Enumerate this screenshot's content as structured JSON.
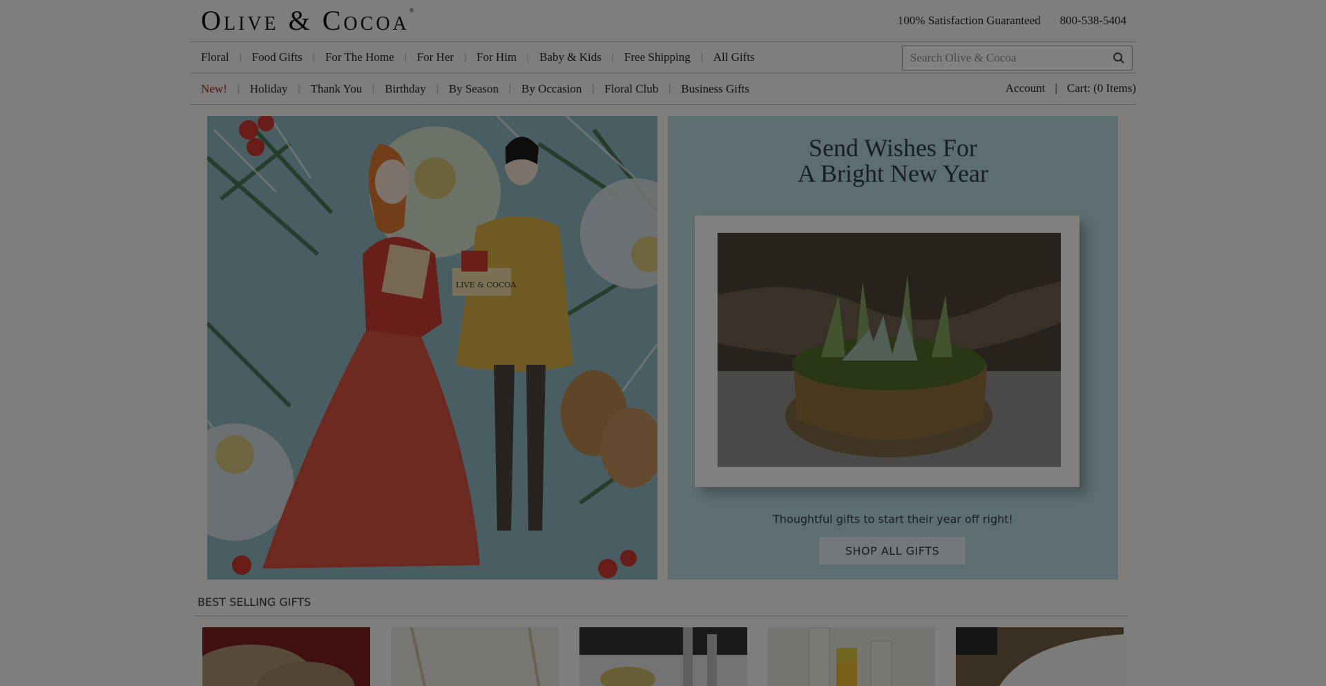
{
  "brand": {
    "logo_text": "Olive & Cocoa",
    "logo_mark": "®"
  },
  "header": {
    "guarantee": "100% Satisfaction Guaranteed",
    "phone": "800-538-5404"
  },
  "nav_primary": [
    "Floral",
    "Food Gifts",
    "For The Home",
    "For Her",
    "For Him",
    "Baby & Kids",
    "Free Shipping",
    "All Gifts"
  ],
  "search": {
    "placeholder": "Search Olive & Cocoa",
    "icon": "search-icon"
  },
  "nav_secondary": [
    "New!",
    "Holiday",
    "Thank You",
    "Birthday",
    "By Season",
    "By Occasion",
    "Floral Club",
    "Business Gifts"
  ],
  "account": {
    "account_label": "Account",
    "separator": "|",
    "cart_label": "Cart: (0 Items)"
  },
  "hero": {
    "title_line1": "Send Wishes For",
    "title_line2": "A Bright New Year",
    "subtitle": "Thoughtful gifts to start their year off right!",
    "cta_label": "SHOP ALL GIFTS",
    "illustration_box_text": "LIVE & COCOA"
  },
  "best_selling": {
    "heading": "BEST SELLING GIFTS"
  },
  "colors": {
    "accent_new": "#9a2a22",
    "hero_panel": "#b3d3d8",
    "overlay": "rgba(0,0,0,0.48)"
  }
}
